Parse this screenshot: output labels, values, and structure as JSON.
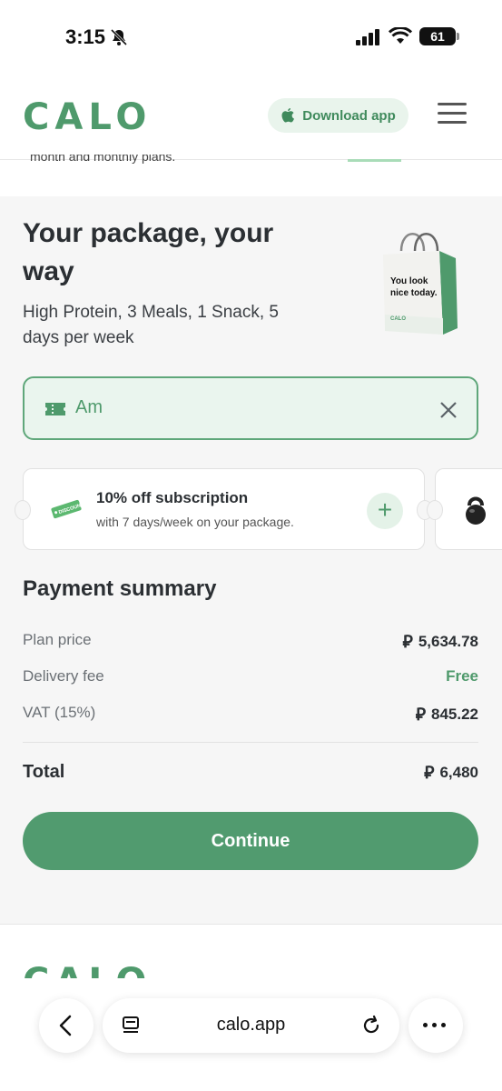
{
  "status_bar": {
    "time": "3:15",
    "battery": "61"
  },
  "header": {
    "logo": "CALO",
    "download_label": "Download app"
  },
  "cut_text": "month and monthly plans.",
  "package": {
    "title": "Your package, your way",
    "subtitle": "High Protein, 3 Meals, 1 Snack, 5 days per week",
    "bag_text": "You look nice today.",
    "bag_brand": "CALO"
  },
  "promo": {
    "value": "Am"
  },
  "coupon": {
    "tag": "DISCOUNT",
    "title": "10% off subscription",
    "subtitle": "with 7 days/week on your package.",
    "add_label": "+"
  },
  "summary": {
    "title": "Payment summary",
    "currency_symbol": "⃁",
    "rows": [
      {
        "label": "Plan price",
        "value": "5,634.78"
      },
      {
        "label": "Delivery fee",
        "value": "Free"
      },
      {
        "label": "VAT (15%)",
        "value": "845.22"
      }
    ],
    "total_label": "Total",
    "total_value": "6,480"
  },
  "continue_label": "Continue",
  "footer_logo": "CALO",
  "browser": {
    "url": "calo.app"
  },
  "colors": {
    "brand": "#4f9a6c",
    "button": "#519b6f",
    "panel": "#f6f6f6"
  }
}
